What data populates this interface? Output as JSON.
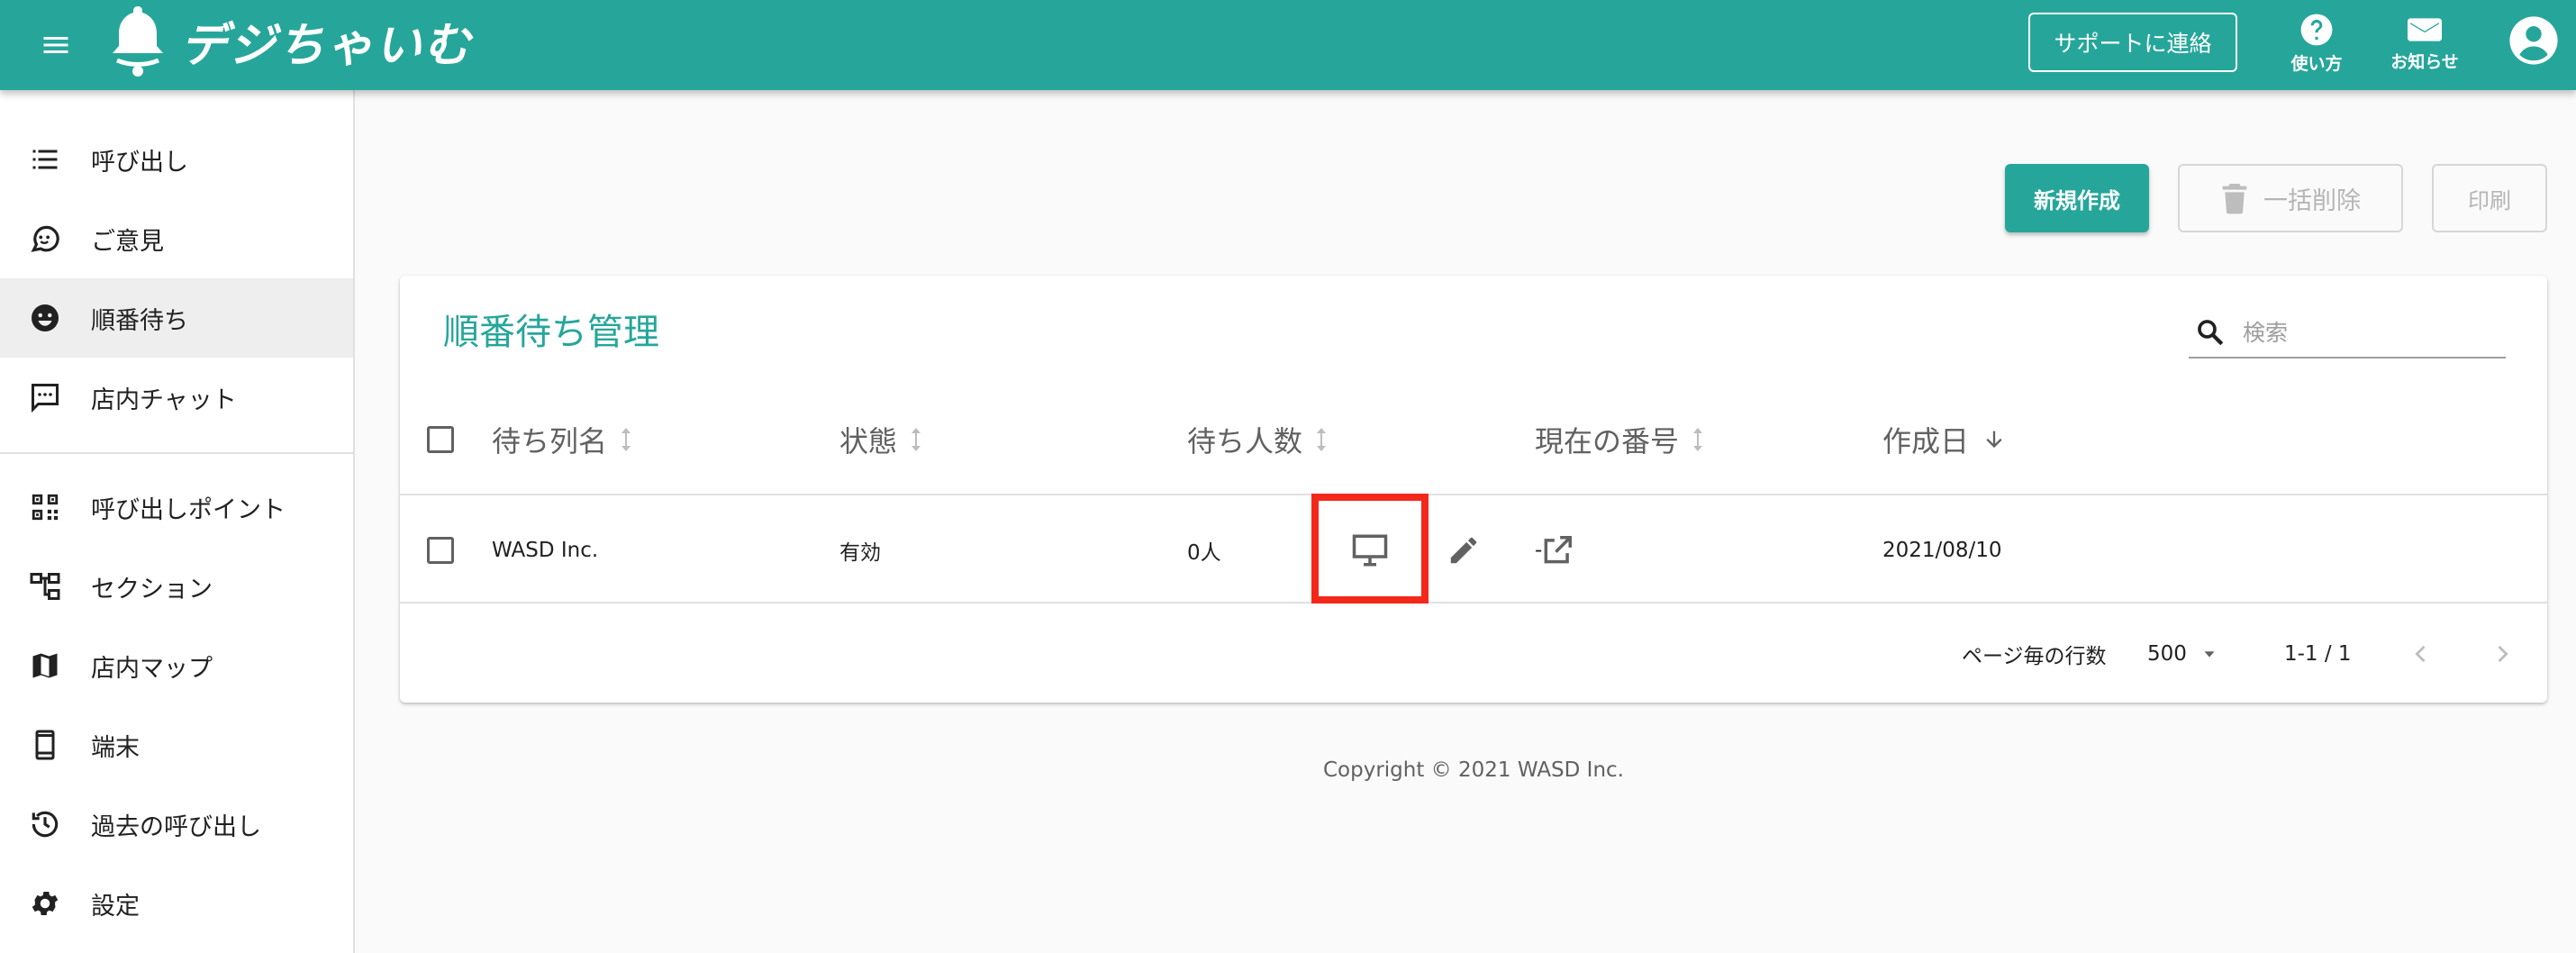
{
  "app": {
    "logo_text": "デジちゃいむ",
    "support_label": "サポートに連絡",
    "help_label": "使い方",
    "news_label": "お知らせ"
  },
  "sidebar": {
    "items": [
      {
        "label": "呼び出し",
        "icon": "list-icon"
      },
      {
        "label": "ご意見",
        "icon": "feedback-icon"
      },
      {
        "label": "順番待ち",
        "icon": "face-icon",
        "active": true
      },
      {
        "label": "店内チャット",
        "icon": "chat-icon"
      },
      {
        "label": "呼び出しポイント",
        "icon": "qr-code-icon"
      },
      {
        "label": "セクション",
        "icon": "hierarchy-icon"
      },
      {
        "label": "店内マップ",
        "icon": "map-icon"
      },
      {
        "label": "端末",
        "icon": "smartphone-icon"
      },
      {
        "label": "過去の呼び出し",
        "icon": "history-icon"
      },
      {
        "label": "設定",
        "icon": "gear-icon"
      }
    ]
  },
  "actions": {
    "new_label": "新規作成",
    "bulk_delete_label": "一括削除",
    "print_label": "印刷"
  },
  "card": {
    "title": "順番待ち管理",
    "search_placeholder": "検索"
  },
  "table": {
    "columns": [
      "待ち列名",
      "状態",
      "待ち人数",
      "現在の番号",
      "作成日"
    ],
    "rows": [
      {
        "name": "WASD Inc.",
        "status": "有効",
        "waiting": "0人",
        "current": "-",
        "created": "2021/08/10"
      }
    ]
  },
  "pagination": {
    "rows_per_page_label": "ページ毎の行数",
    "rows_per_page": "500",
    "range": "1-1 / 1"
  },
  "footer": {
    "copyright": "Copyright © 2021 WASD Inc."
  },
  "colors": {
    "primary": "#26a69a",
    "highlight": "#f4281a"
  }
}
